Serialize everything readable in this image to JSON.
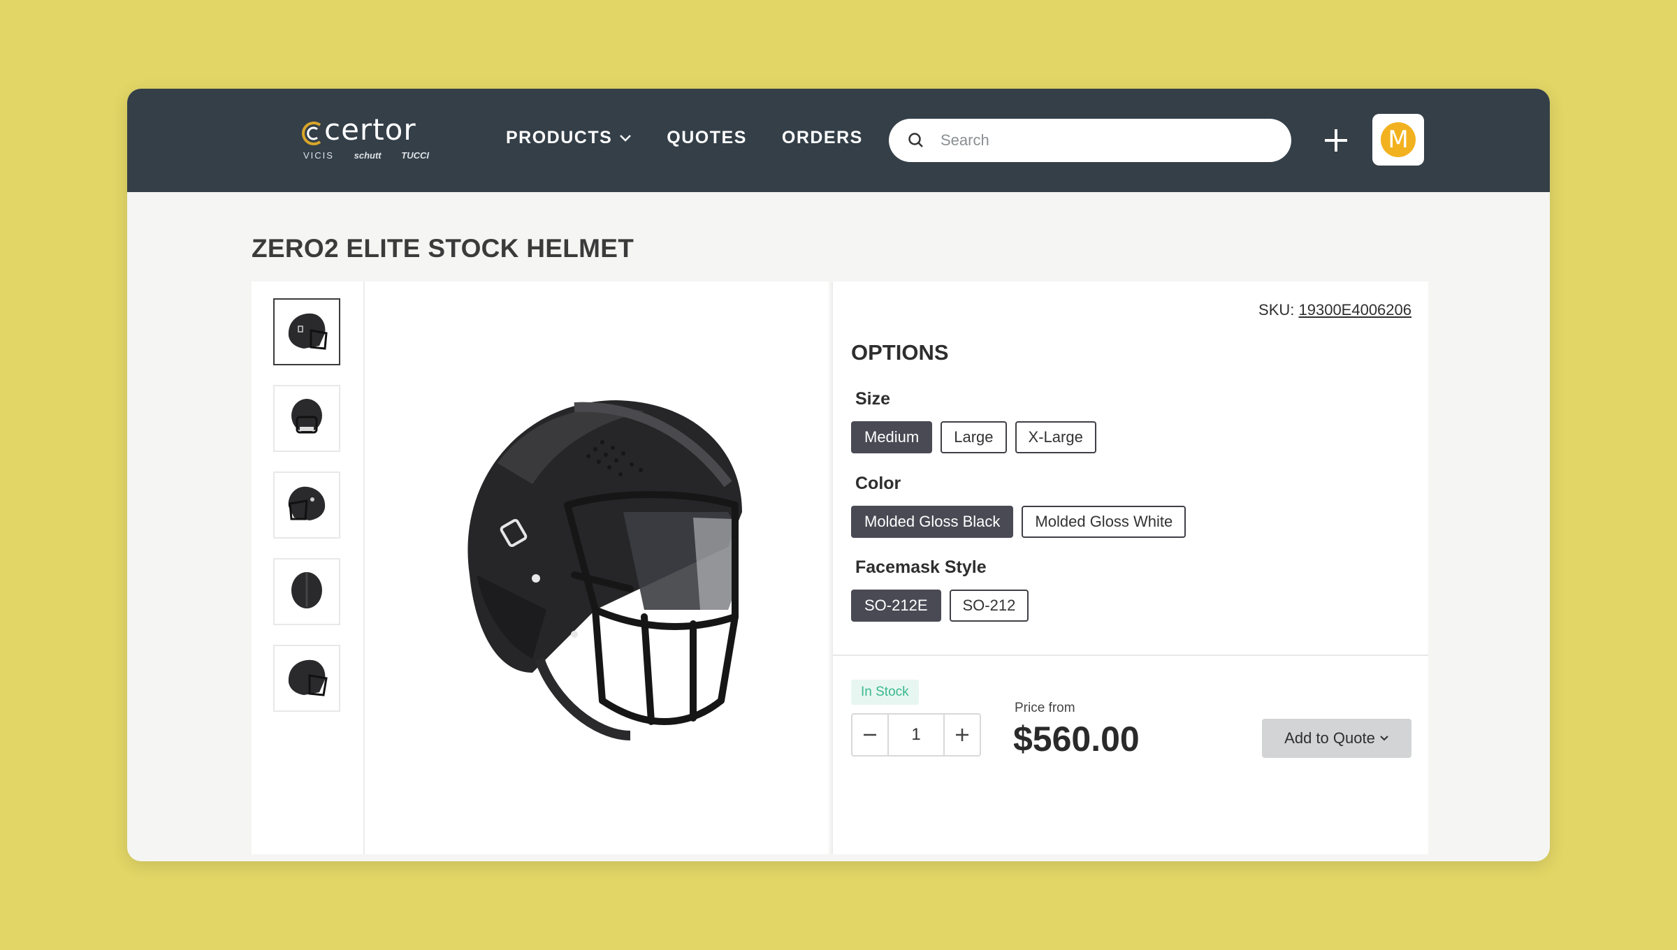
{
  "brand": {
    "name": "certor",
    "sub_brands": [
      "VICIS",
      "schutt",
      "TUCCI"
    ],
    "accent": "#d9a52a"
  },
  "nav": {
    "items": [
      {
        "label": "PRODUCTS",
        "has_dropdown": true
      },
      {
        "label": "QUOTES"
      },
      {
        "label": "ORDERS"
      }
    ]
  },
  "search": {
    "placeholder": "Search",
    "value": ""
  },
  "user": {
    "avatar_initial": "M",
    "avatar_color": "#f2b21f"
  },
  "product": {
    "title": "ZERO2 ELITE STOCK HELMET",
    "sku_label": "SKU:",
    "sku": "19300E4006206",
    "thumbnail_count": 5,
    "selected_thumbnail": 1
  },
  "options": {
    "title": "OPTIONS",
    "size": {
      "label": "Size",
      "choices": [
        "Medium",
        "Large",
        "X-Large"
      ],
      "selected": "Medium"
    },
    "color": {
      "label": "Color",
      "choices": [
        "Molded Gloss Black",
        "Molded Gloss White"
      ],
      "selected": "Molded Gloss Black"
    },
    "facemask": {
      "label": "Facemask Style",
      "choices": [
        "SO-212E",
        "SO-212"
      ],
      "selected": "SO-212E"
    }
  },
  "purchase": {
    "stock_status": "In Stock",
    "quantity": "1",
    "price_from_label": "Price from",
    "price": "$560.00",
    "add_button": "Add to Quote"
  },
  "colors": {
    "background": "#e2d666",
    "topbar": "#343f48",
    "chip_active": "#4a4a55",
    "in_stock": "#38b98f"
  }
}
